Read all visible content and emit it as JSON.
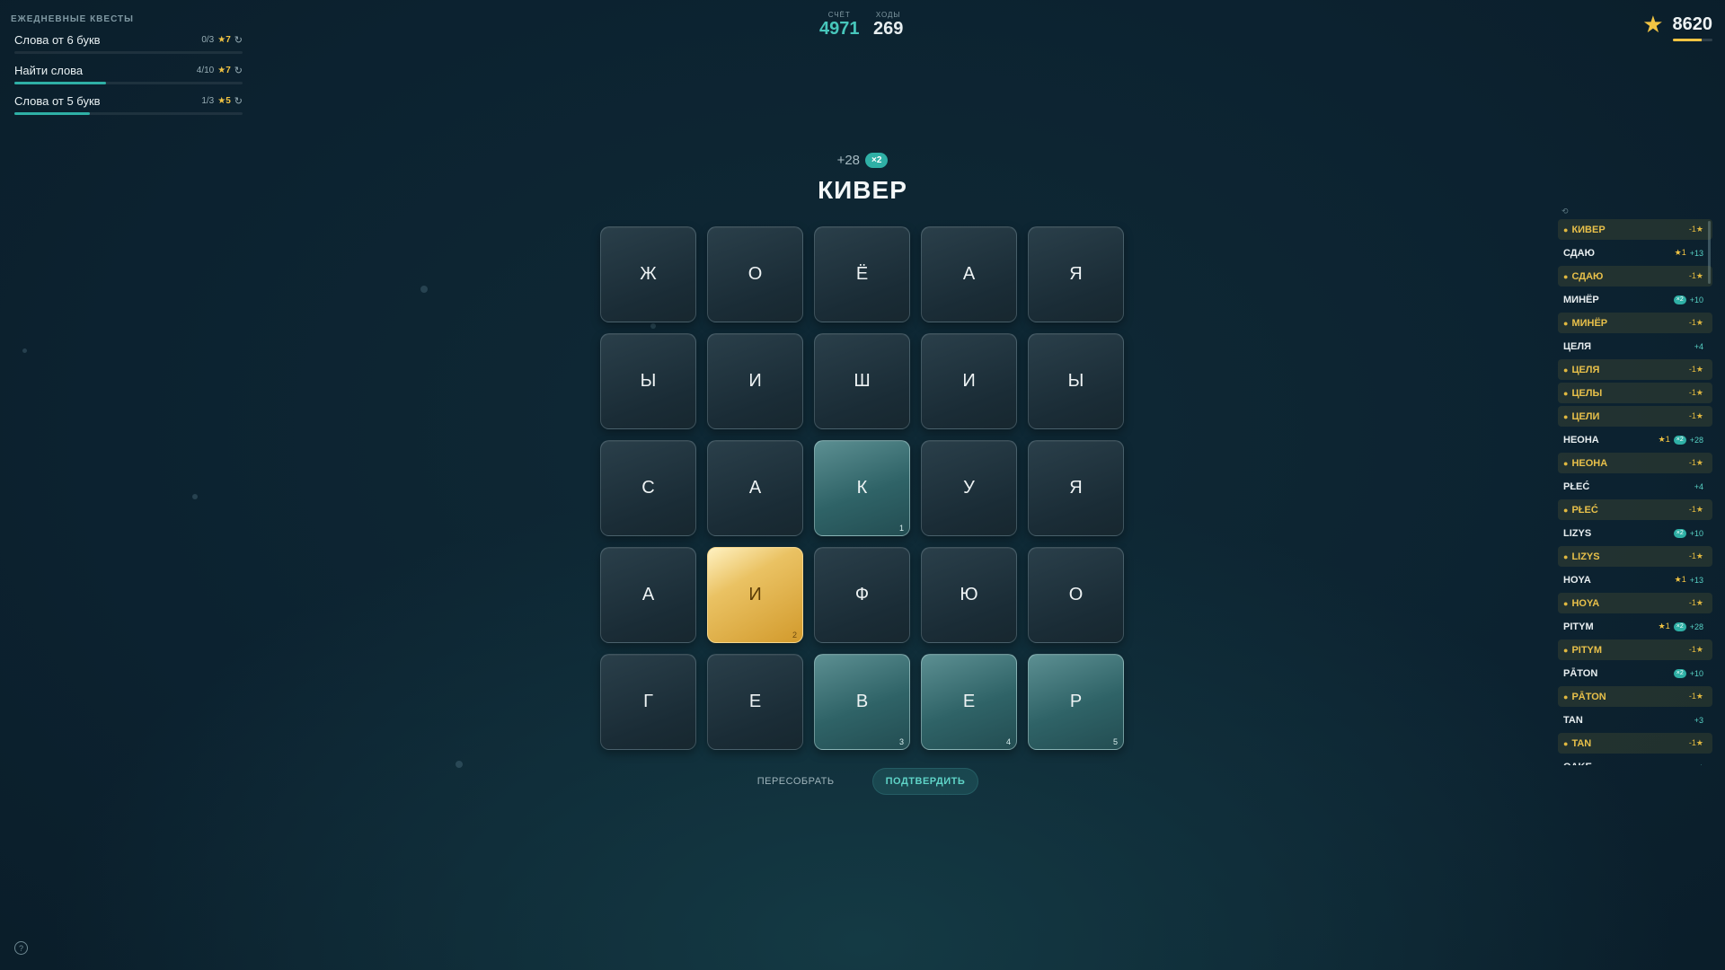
{
  "quests": {
    "title": "ЕЖЕДНЕВНЫЕ КВЕСТЫ",
    "items": [
      {
        "name": "Слова от 6 букв",
        "progress": "0/3",
        "reward": "★7",
        "progress_fraction": 0.0
      },
      {
        "name": "Найти слова",
        "progress": "4/10",
        "reward": "★7",
        "progress_fraction": 0.4
      },
      {
        "name": "Слова от 5 букв",
        "progress": "1/3",
        "reward": "★5",
        "progress_fraction": 0.33
      }
    ]
  },
  "header": {
    "score_label": "СЧЁТ",
    "score_value": "4971",
    "moves_label": "ХОДЫ",
    "moves_value": "269",
    "stars_value": "8620"
  },
  "current": {
    "points": "+28",
    "multiplier": "×2",
    "word": "КИВЕР"
  },
  "grid": [
    [
      {
        "l": "Ж"
      },
      {
        "l": "О"
      },
      {
        "l": "Ё"
      },
      {
        "l": "А"
      },
      {
        "l": "Я"
      }
    ],
    [
      {
        "l": "Ы"
      },
      {
        "l": "И"
      },
      {
        "l": "Ш"
      },
      {
        "l": "И"
      },
      {
        "l": "Ы"
      }
    ],
    [
      {
        "l": "С"
      },
      {
        "l": "А"
      },
      {
        "l": "К",
        "sel": true,
        "n": "1"
      },
      {
        "l": "У"
      },
      {
        "l": "Я"
      }
    ],
    [
      {
        "l": "А"
      },
      {
        "l": "И",
        "gold": true,
        "n": "2"
      },
      {
        "l": "Ф"
      },
      {
        "l": "Ю"
      },
      {
        "l": "О"
      }
    ],
    [
      {
        "l": "Г"
      },
      {
        "l": "Е"
      },
      {
        "l": "В",
        "sel": true,
        "n": "3"
      },
      {
        "l": "Е",
        "sel": true,
        "n": "4"
      },
      {
        "l": "Р",
        "sel": true,
        "n": "5"
      }
    ]
  ],
  "actions": {
    "reshuffle": "ПЕРЕСОБРАТЬ",
    "confirm": "ПОДТВЕРДИТЬ"
  },
  "words": [
    {
      "word": "КИВЕР",
      "penalty": true,
      "cost": "-1★"
    },
    {
      "word": "СДАЮ",
      "stars": "★1",
      "points": "+13"
    },
    {
      "word": "СДАЮ",
      "penalty": true,
      "cost": "-1★"
    },
    {
      "word": "МИНЁР",
      "mult": "×2",
      "points": "+10"
    },
    {
      "word": "МИНЁР",
      "penalty": true,
      "cost": "-1★"
    },
    {
      "word": "ЦЕЛЯ",
      "points": "+4"
    },
    {
      "word": "ЦЕЛЯ",
      "penalty": true,
      "cost": "-1★"
    },
    {
      "word": "ЦЕЛЫ",
      "penalty": true,
      "cost": "-1★"
    },
    {
      "word": "ЦЕЛИ",
      "penalty": true,
      "cost": "-1★"
    },
    {
      "word": "НЕОНА",
      "stars": "★1",
      "mult": "×2",
      "points": "+28"
    },
    {
      "word": "НЕОНА",
      "penalty": true,
      "cost": "-1★"
    },
    {
      "word": "PŁEĆ",
      "points": "+4"
    },
    {
      "word": "PŁEĆ",
      "penalty": true,
      "cost": "-1★"
    },
    {
      "word": "LIZYS",
      "mult": "×2",
      "points": "+10"
    },
    {
      "word": "LIZYS",
      "penalty": true,
      "cost": "-1★"
    },
    {
      "word": "HOYA",
      "stars": "★1",
      "points": "+13"
    },
    {
      "word": "HOYA",
      "penalty": true,
      "cost": "-1★"
    },
    {
      "word": "PITYM",
      "stars": "★1",
      "mult": "×2",
      "points": "+28"
    },
    {
      "word": "PITYM",
      "penalty": true,
      "cost": "-1★"
    },
    {
      "word": "PĀTON",
      "mult": "×2",
      "points": "+10"
    },
    {
      "word": "PĀTON",
      "penalty": true,
      "cost": "-1★"
    },
    {
      "word": "TAN",
      "points": "+3"
    },
    {
      "word": "TAN",
      "penalty": true,
      "cost": "-1★"
    },
    {
      "word": "OAKE",
      "points": "+"
    }
  ],
  "colors": {
    "accent": "#2fb0a6",
    "gold": "#f2c443",
    "bg": "#0e2633"
  }
}
